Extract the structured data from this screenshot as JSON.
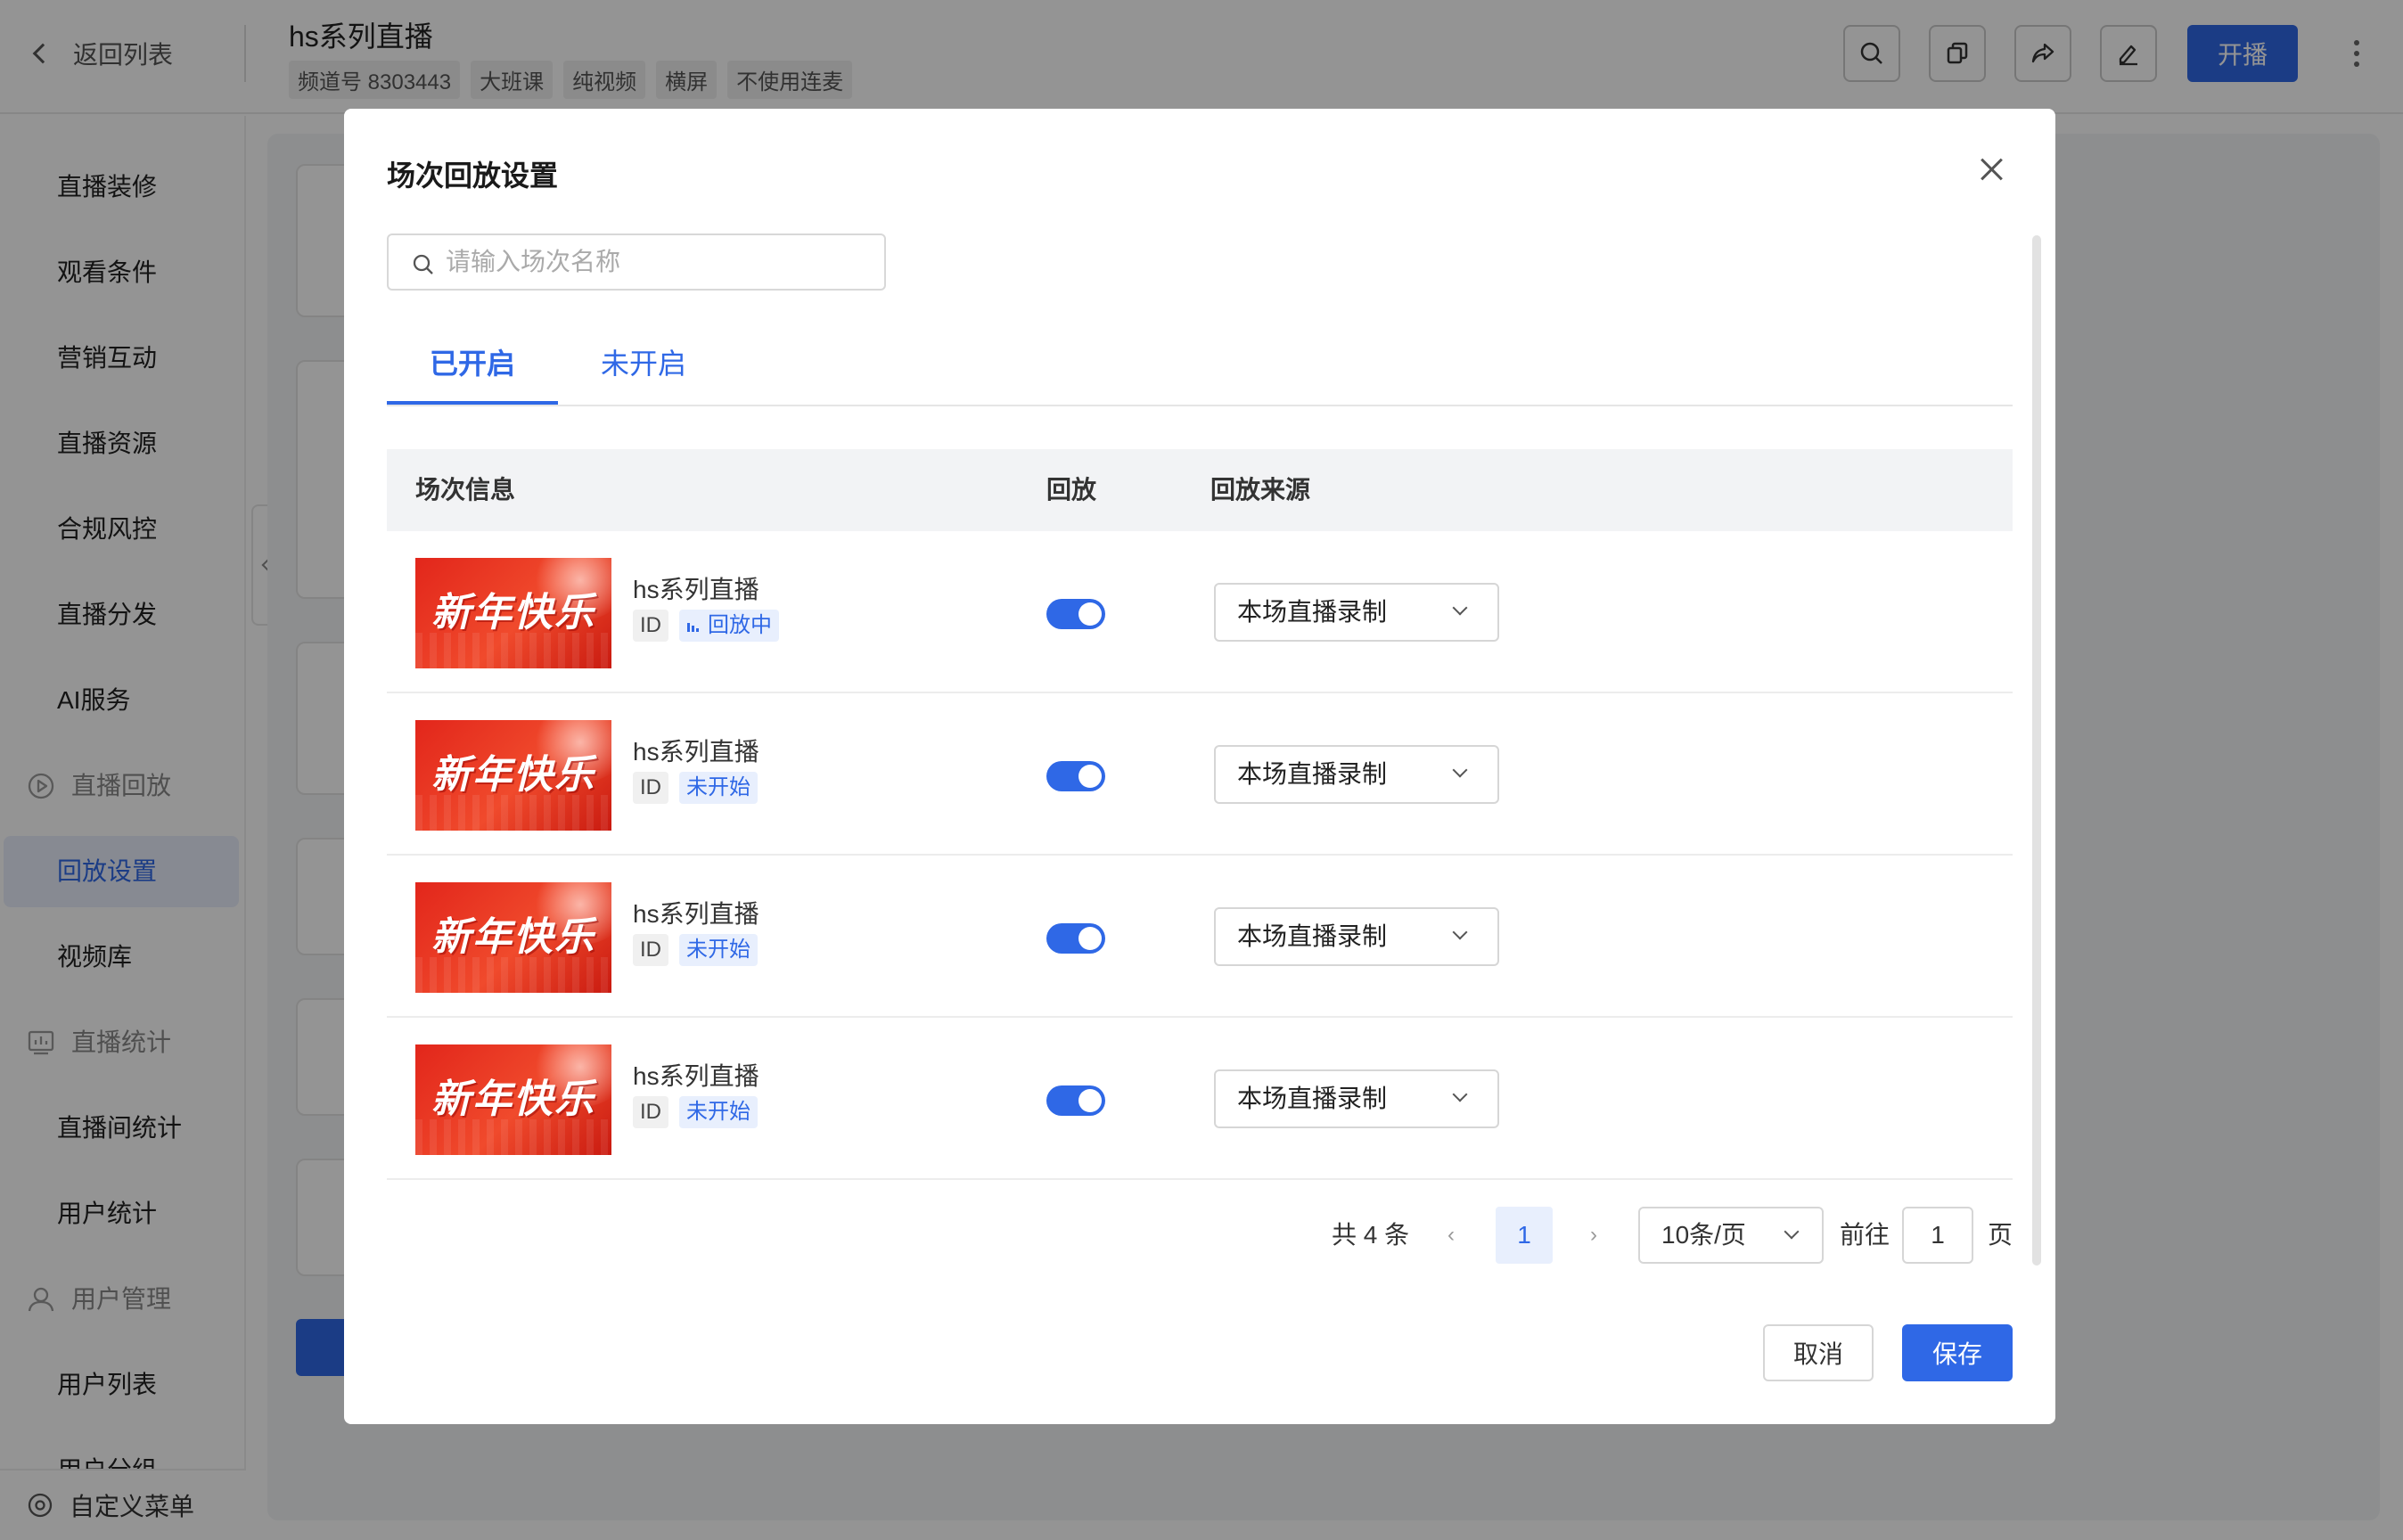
{
  "header": {
    "back_label": "返回列表",
    "title": "hs系列直播",
    "tags": [
      "频道号 8303443",
      "大班课",
      "纯视频",
      "横屏",
      "不使用连麦"
    ],
    "start_label": "开播"
  },
  "sidebar": {
    "items": [
      {
        "label": "直播装修",
        "type": "item"
      },
      {
        "label": "观看条件",
        "type": "item"
      },
      {
        "label": "营销互动",
        "type": "item"
      },
      {
        "label": "直播资源",
        "type": "item"
      },
      {
        "label": "合规风控",
        "type": "item"
      },
      {
        "label": "直播分发",
        "type": "item"
      },
      {
        "label": "AI服务",
        "type": "item"
      },
      {
        "label": "直播回放",
        "type": "group",
        "icon": "play-circle-icon"
      },
      {
        "label": "回放设置",
        "type": "item",
        "active": true
      },
      {
        "label": "视频库",
        "type": "item"
      },
      {
        "label": "直播统计",
        "type": "group",
        "icon": "chart-icon"
      },
      {
        "label": "直播间统计",
        "type": "item"
      },
      {
        "label": "用户统计",
        "type": "item"
      },
      {
        "label": "用户管理",
        "type": "group",
        "icon": "user-icon"
      },
      {
        "label": "用户列表",
        "type": "item"
      },
      {
        "label": "用户分组",
        "type": "item"
      }
    ],
    "bottom_label": "自定义菜单"
  },
  "modal": {
    "title": "场次回放设置",
    "search_placeholder": "请输入场次名称",
    "tabs": [
      {
        "label": "已开启",
        "active": true
      },
      {
        "label": "未开启",
        "active": false
      }
    ],
    "columns": [
      "场次信息",
      "回放",
      "回放来源"
    ],
    "rows": [
      {
        "thumb_text": "新年快乐",
        "title": "hs系列直播",
        "id_label": "ID",
        "status": "回放中",
        "playing": true,
        "replay_on": true,
        "source": "本场直播录制"
      },
      {
        "thumb_text": "新年快乐",
        "title": "hs系列直播",
        "id_label": "ID",
        "status": "未开始",
        "playing": false,
        "replay_on": true,
        "source": "本场直播录制"
      },
      {
        "thumb_text": "新年快乐",
        "title": "hs系列直播",
        "id_label": "ID",
        "status": "未开始",
        "playing": false,
        "replay_on": true,
        "source": "本场直播录制"
      },
      {
        "thumb_text": "新年快乐",
        "title": "hs系列直播",
        "id_label": "ID",
        "status": "未开始",
        "playing": false,
        "replay_on": true,
        "source": "本场直播录制"
      }
    ],
    "pagination": {
      "total": "共 4 条",
      "current_page": "1",
      "page_size": "10条/页",
      "goto_label": "前往",
      "goto_value": "1",
      "page_unit": "页"
    },
    "cancel_label": "取消",
    "save_label": "保存"
  },
  "colors": {
    "primary": "#2f68e6",
    "overlay": "rgba(0,0,0,0.42)",
    "active_bg": "#e9eefb"
  }
}
